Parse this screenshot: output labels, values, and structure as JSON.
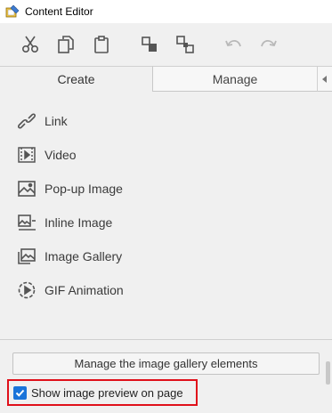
{
  "window": {
    "title": "Content Editor"
  },
  "toolbar": {
    "buttons": [
      {
        "icon": "cut-icon",
        "enabled": true
      },
      {
        "icon": "copy-icon",
        "enabled": true
      },
      {
        "icon": "paste-icon",
        "enabled": true
      },
      {
        "icon": "group-icon",
        "enabled": true
      },
      {
        "icon": "ungroup-icon",
        "enabled": true
      },
      {
        "icon": "undo-icon",
        "enabled": false
      },
      {
        "icon": "redo-icon",
        "enabled": false
      }
    ]
  },
  "tabs": [
    {
      "label": "Create",
      "active": true
    },
    {
      "label": "Manage",
      "active": false
    }
  ],
  "items": [
    {
      "label": "Link",
      "icon": "link-icon"
    },
    {
      "label": "Video",
      "icon": "video-icon"
    },
    {
      "label": "Pop-up Image",
      "icon": "image-icon"
    },
    {
      "label": "Inline Image",
      "icon": "inline-image-icon"
    },
    {
      "label": "Image Gallery",
      "icon": "gallery-icon"
    },
    {
      "label": "GIF Animation",
      "icon": "gif-icon"
    }
  ],
  "footer": {
    "manage_button_label": "Manage the image gallery elements",
    "preview_checkbox_label": "Show image preview on page",
    "preview_checked": true
  },
  "colors": {
    "accent": "#1a73d9",
    "highlight": "#e0101a",
    "icon": "#555555",
    "disabled_icon": "#b8b8b8"
  }
}
